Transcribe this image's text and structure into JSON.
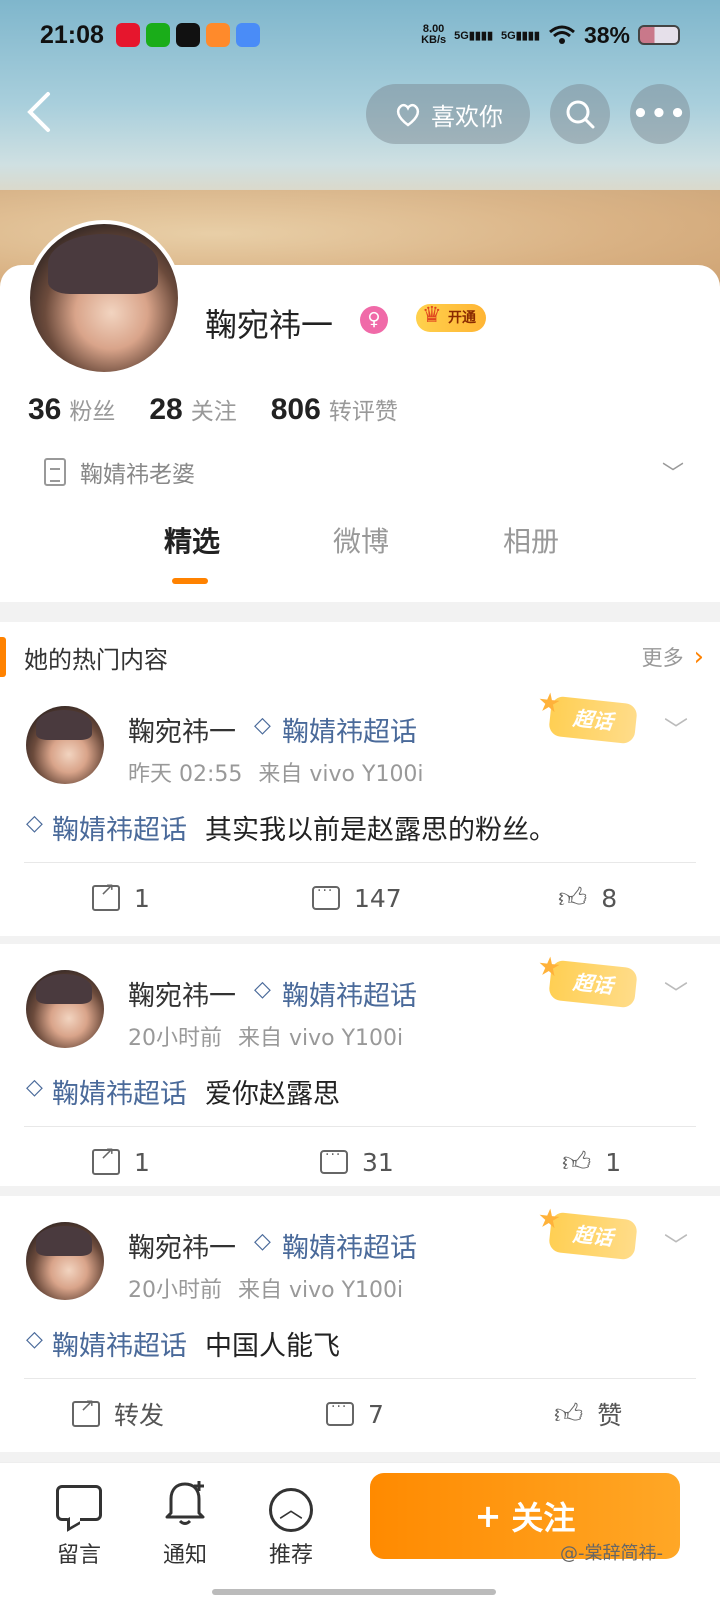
{
  "status_bar": {
    "time": "21:08",
    "net_speed": "8.00",
    "net_unit": "KB/s",
    "signal1": "5G",
    "signal2": "5G",
    "battery": "38%",
    "app_icons": [
      "weibo-icon",
      "wechat-icon",
      "tiktok-icon",
      "video-icon",
      "cloud-icon"
    ]
  },
  "nav": {
    "like_you": "喜欢你"
  },
  "profile": {
    "nickname": "鞠宛祎一",
    "vip_label": "开通",
    "stats": [
      {
        "num": "36",
        "label": "粉丝"
      },
      {
        "num": "28",
        "label": "关注"
      },
      {
        "num": "806",
        "label": "转评赞"
      }
    ],
    "bio": "鞠婧祎老婆"
  },
  "tabs": [
    {
      "label": "精选",
      "active": true
    },
    {
      "label": "微博",
      "active": false
    },
    {
      "label": "相册",
      "active": false
    }
  ],
  "hot": {
    "title": "她的热门内容",
    "more": "更多"
  },
  "posts": [
    {
      "author": "鞠宛祎一",
      "topic": "鞠婧祎超话",
      "time": "昨天 02:55",
      "source": "来自 vivo Y100i",
      "badge": "超话",
      "tag": "鞠婧祎超话",
      "text": "其实我以前是赵露思的粉丝。",
      "repost": "1",
      "comment": "147",
      "like": "8"
    },
    {
      "author": "鞠宛祎一",
      "topic": "鞠婧祎超话",
      "time": "20小时前",
      "source": "来自 vivo Y100i",
      "badge": "超话",
      "tag": "鞠婧祎超话",
      "text": "爱你赵露思",
      "repost": "1",
      "comment": "31",
      "like": "1"
    },
    {
      "author": "鞠宛祎一",
      "topic": "鞠婧祎超话",
      "time": "20小时前",
      "source": "来自 vivo Y100i",
      "badge": "超话",
      "tag": "鞠婧祎超话",
      "text": "中国人能飞",
      "repost": "转发",
      "comment": "7",
      "like": "赞"
    }
  ],
  "bottom_bar": {
    "message": "留言",
    "notify": "通知",
    "recommend": "推荐",
    "follow": "关注",
    "follow_plus": "+",
    "watermark": "@-棠辞简祎-"
  },
  "colors": {
    "accent": "#ff8200",
    "topic_blue": "#4a6a9a"
  }
}
